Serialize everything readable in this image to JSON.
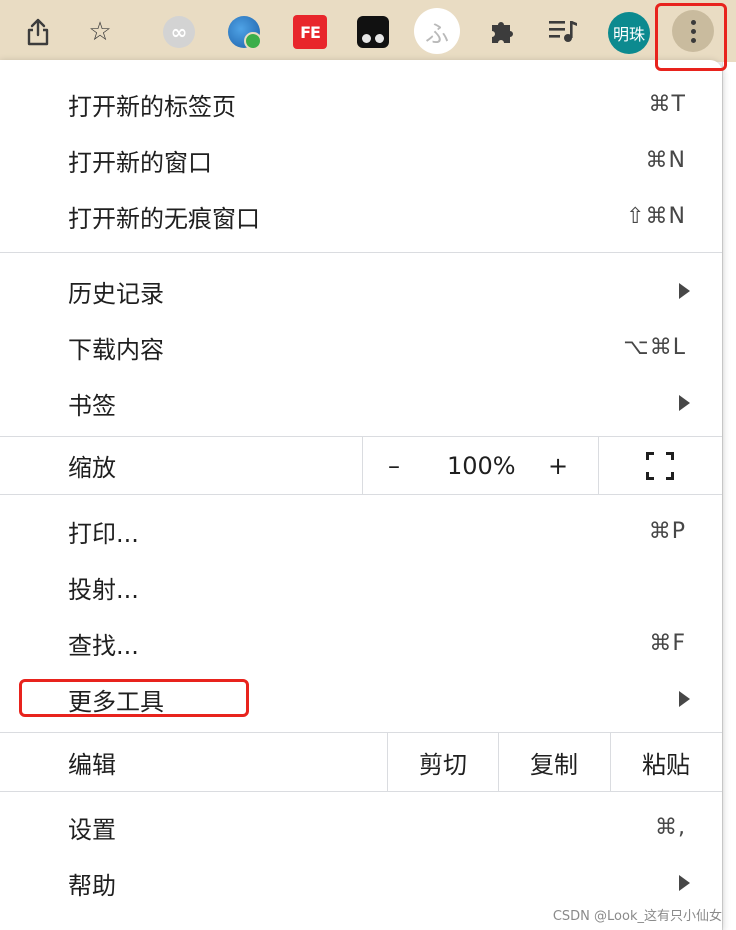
{
  "toolbar": {
    "share_icon": "share-icon",
    "star_icon": "star-icon",
    "extensions": [
      "loop-extension-icon",
      "globe-extension-icon",
      "fe-extension-icon",
      "owl-extension-icon",
      "fu-extension-icon",
      "puzzle-icon",
      "playlist-icon"
    ],
    "fe_label": "FE",
    "fu_label": "ふ",
    "avatar_label": "明珠",
    "menu_icon": "more-vert-icon"
  },
  "menu": {
    "new_tab": {
      "label": "打开新的标签页",
      "shortcut": "⌘T"
    },
    "new_window": {
      "label": "打开新的窗口",
      "shortcut": "⌘N"
    },
    "new_incognito": {
      "label": "打开新的无痕窗口",
      "shortcut": "⇧⌘N"
    },
    "history": {
      "label": "历史记录"
    },
    "downloads": {
      "label": "下载内容",
      "shortcut": "⌥⌘L"
    },
    "bookmarks": {
      "label": "书签"
    },
    "zoom": {
      "label": "缩放",
      "minus": "–",
      "value": "100%",
      "plus": "+"
    },
    "print": {
      "label": "打印...",
      "shortcut": "⌘P"
    },
    "cast": {
      "label": "投射..."
    },
    "find": {
      "label": "查找...",
      "shortcut": "⌘F"
    },
    "more_tools": {
      "label": "更多工具"
    },
    "edit": {
      "label": "编辑",
      "cut": "剪切",
      "copy": "复制",
      "paste": "粘贴"
    },
    "settings": {
      "label": "设置",
      "shortcut": "⌘,"
    },
    "help": {
      "label": "帮助"
    }
  },
  "colors": {
    "highlight": "#e8231d",
    "toolbar": "#e9dcc3",
    "avatar": "#0c8a8f"
  },
  "watermark": "CSDN @Look_这有只小仙女"
}
